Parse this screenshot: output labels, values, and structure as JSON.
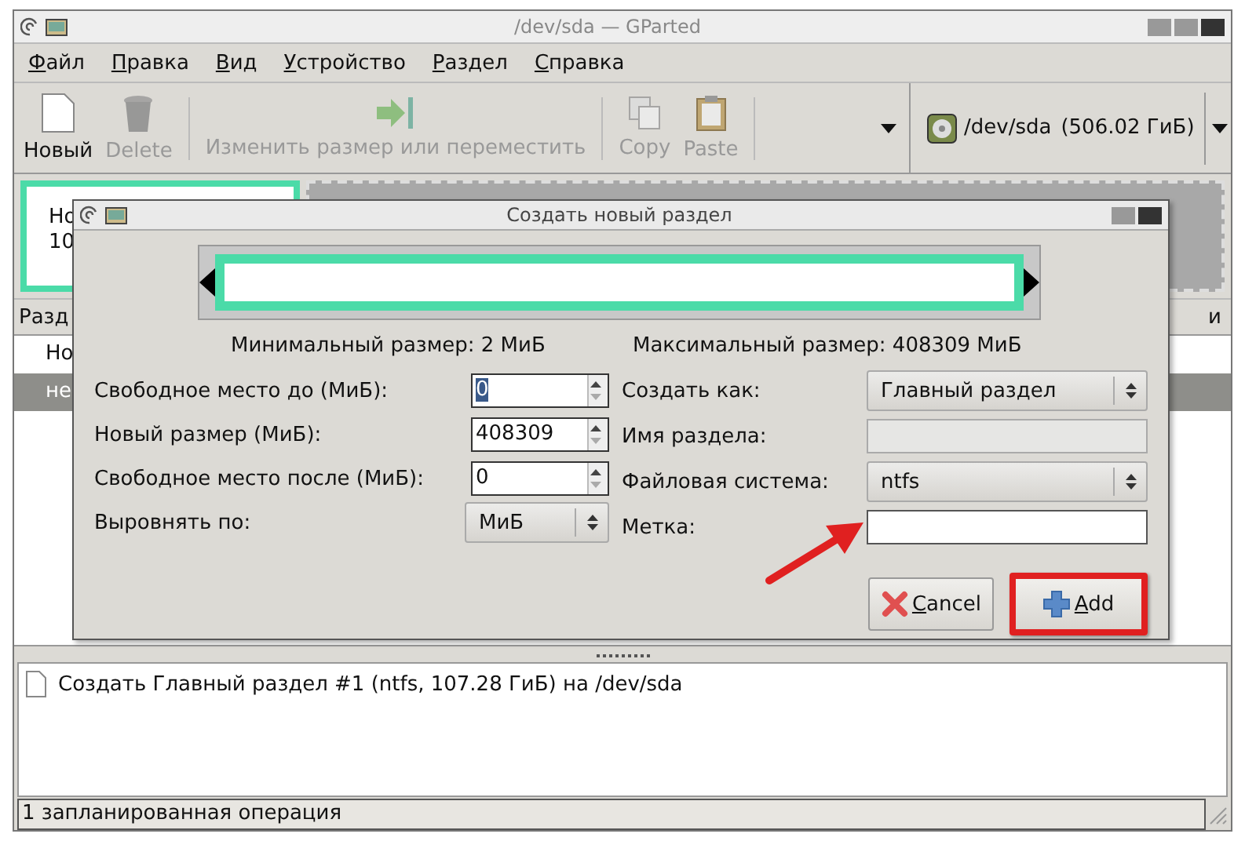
{
  "window": {
    "title": "/dev/sda — GParted"
  },
  "menu": [
    {
      "label": "Файл"
    },
    {
      "label": "Правка"
    },
    {
      "label": "Вид"
    },
    {
      "label": "Устройство"
    },
    {
      "label": "Раздел"
    },
    {
      "label": "Справка"
    }
  ],
  "toolbar": [
    {
      "kind": "new",
      "label": "Новый",
      "disabled": false
    },
    {
      "kind": "delete",
      "label": "Delete",
      "disabled": true
    },
    {
      "kind": "separator"
    },
    {
      "kind": "resize",
      "label": "Изменить размер или переместить",
      "disabled": true
    },
    {
      "kind": "separator"
    },
    {
      "kind": "copy",
      "label": "Copy",
      "disabled": true
    },
    {
      "kind": "paste",
      "label": "Paste",
      "disabled": true
    },
    {
      "kind": "separator"
    }
  ],
  "device": {
    "path": "/dev/sda",
    "size": "(506.02 ГиБ)"
  },
  "disk_map": {
    "partition_text": [
      "Но",
      "10"
    ]
  },
  "table": {
    "column_1": "Разд",
    "column_last": "и",
    "rows": [
      {
        "cell": "Но",
        "selected": false
      },
      {
        "cell": "не",
        "selected": true
      }
    ]
  },
  "dialog": {
    "title": "Создать новый раздел",
    "min_size": "Минимальный размер: 2 МиБ",
    "max_size": "Максимальный размер: 408309 МиБ",
    "left_fields": [
      {
        "kind": "spin",
        "label": "Свободное место до (МиБ):",
        "value": "0",
        "text_selected": true
      },
      {
        "kind": "spin",
        "label": "Новый размер (МиБ):",
        "value": "408309",
        "text_selected": false
      },
      {
        "kind": "spin",
        "label": "Свободное место после (МиБ):",
        "value": "0",
        "text_selected": false
      },
      {
        "kind": "combo",
        "label": "Выровнять по:",
        "value": "МиБ"
      }
    ],
    "right_fields": [
      {
        "kind": "combo",
        "label": "Создать как:",
        "value": "Главный раздел"
      },
      {
        "kind": "entry",
        "label": "Имя раздела:",
        "disabled": true
      },
      {
        "kind": "combo",
        "label": "Файловая система:",
        "value": "ntfs"
      },
      {
        "kind": "entry",
        "label": "Метка:",
        "disabled": false
      }
    ],
    "buttons": [
      {
        "kind": "cancel",
        "label": "Cancel",
        "highlighted": false
      },
      {
        "kind": "add",
        "label": "Add",
        "highlighted": true
      }
    ]
  },
  "operations": [
    {
      "text": "Создать Главный раздел #1 (ntfs, 107.28 ГиБ) на /dev/sda"
    }
  ],
  "status_bar": "1 запланированная операция"
}
